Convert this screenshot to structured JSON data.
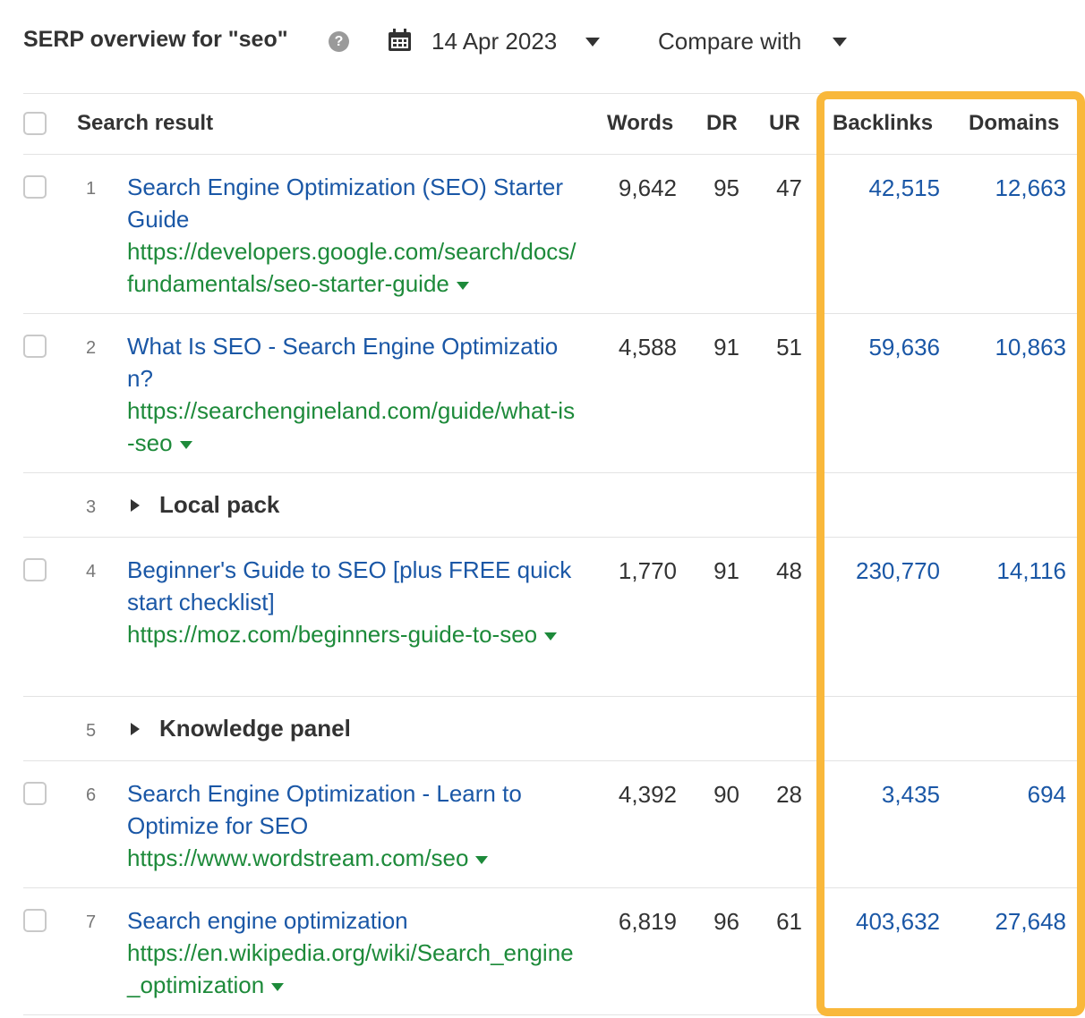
{
  "header": {
    "title": "SERP overview for \"seo\"",
    "help_icon": "?",
    "calendar_icon": "calendar-icon",
    "date": "14 Apr 2023",
    "compare": "Compare with"
  },
  "columns": {
    "search_result": "Search result",
    "words": "Words",
    "dr": "DR",
    "ur": "UR",
    "backlinks": "Backlinks",
    "domains": "Domains"
  },
  "rows": [
    {
      "rank": "1",
      "title": "Search Engine Optimization (SEO) Starter Guide",
      "url": "https://developers.google.com/search/docs/fundamentals/seo-starter-guide",
      "words": "9,642",
      "dr": "95",
      "ur": "47",
      "backlinks": "42,515",
      "domains": "12,663"
    },
    {
      "rank": "2",
      "title": "What Is SEO - Search Engine Optimization?",
      "url": "https://searchengineland.com/guide/what-is-seo",
      "words": "4,588",
      "dr": "91",
      "ur": "51",
      "backlinks": "59,636",
      "domains": "10,863"
    },
    {
      "rank": "3",
      "section": "Local pack"
    },
    {
      "rank": "4",
      "title": "Beginner's Guide to SEO [plus FREE quick start checklist]",
      "url": "https://moz.com/beginners-guide-to-seo",
      "words": "1,770",
      "dr": "91",
      "ur": "48",
      "backlinks": "230,770",
      "domains": "14,116"
    },
    {
      "rank": "5",
      "section": "Knowledge panel"
    },
    {
      "rank": "6",
      "title": "Search Engine Optimization - Learn to Optimize for SEO",
      "url": "https://www.wordstream.com/seo",
      "words": "4,392",
      "dr": "90",
      "ur": "28",
      "backlinks": "3,435",
      "domains": "694"
    },
    {
      "rank": "7",
      "title": "Search engine optimization",
      "url": "https://en.wikipedia.org/wiki/Search_engine_optimization",
      "words": "6,819",
      "dr": "96",
      "ur": "61",
      "backlinks": "403,632",
      "domains": "27,648"
    }
  ],
  "colors": {
    "link": "#1a57a6",
    "url": "#1d8a3a",
    "highlight": "#f9b83b"
  }
}
